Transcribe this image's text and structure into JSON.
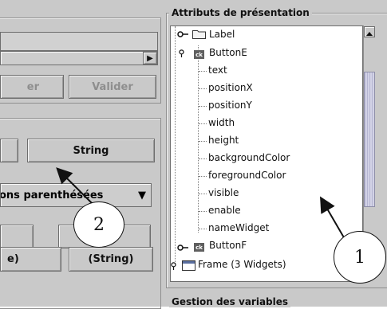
{
  "left": {
    "top_combo_arrow": "▶",
    "button_partial_1": "er",
    "button_validate": "Valider",
    "button_string_1": "String",
    "combo_parens": "ons parenthésées",
    "combo_arrow": "▼",
    "button_partial_2": "e)",
    "button_string_2": "(String)"
  },
  "right": {
    "section_title": "Attributs de présentation",
    "bottom_section_title": "Gestion des variables",
    "tree": {
      "label_item": "Label",
      "buttonE": "ButtonE",
      "ck_badge": "ck",
      "attributes": [
        "text",
        "positionX",
        "positionY",
        "width",
        "height",
        "backgroundColor",
        "foregroundColor",
        "visible",
        "enable",
        "nameWidget"
      ],
      "buttonF": "ButtonF",
      "frame": "Frame (3 Widgets)"
    }
  },
  "annotations": {
    "callout_1": "1",
    "callout_2": "2"
  },
  "colors": {
    "panel_bg": "#c9c9c9",
    "scroll_thumb": "#c8c8de",
    "tree_bg": "#ffffff"
  },
  "icons": [
    "key-expanded-icon",
    "folder-icon",
    "ck-component-icon",
    "frame-icon",
    "scroll-up-arrow-icon",
    "combo-arrow-icon"
  ]
}
